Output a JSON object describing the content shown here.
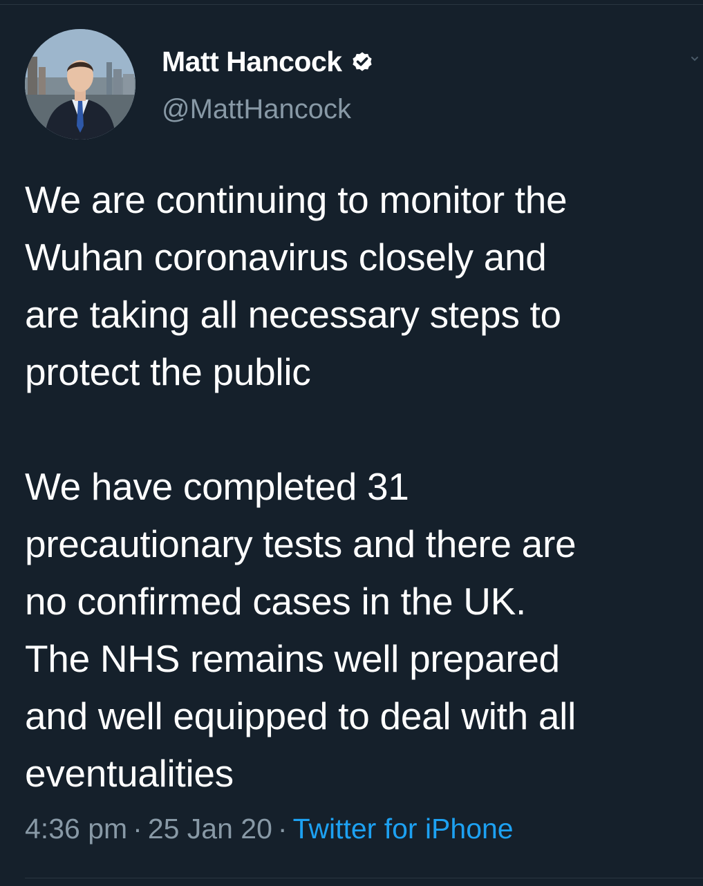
{
  "tweet": {
    "author": {
      "display_name": "Matt Hancock",
      "handle": "@MattHancock",
      "verified": true,
      "avatar_icon": "profile-photo"
    },
    "text": "We are continuing to monitor the\nWuhan coronavirus closely and\nare taking all necessary steps to\nprotect the public\n\nWe have completed 31\nprecautionary tests and there are\nno confirmed cases in the UK.\nThe NHS remains well prepared\nand well equipped to deal with all\neventualities",
    "time": "4:36 pm",
    "separator": "·",
    "date": "25 Jan 20",
    "source": "Twitter for iPhone"
  },
  "colors": {
    "background": "#15202b",
    "text_primary": "#ffffff",
    "text_secondary": "#8899a6",
    "link": "#1da1f2",
    "divider": "#2a3641"
  }
}
